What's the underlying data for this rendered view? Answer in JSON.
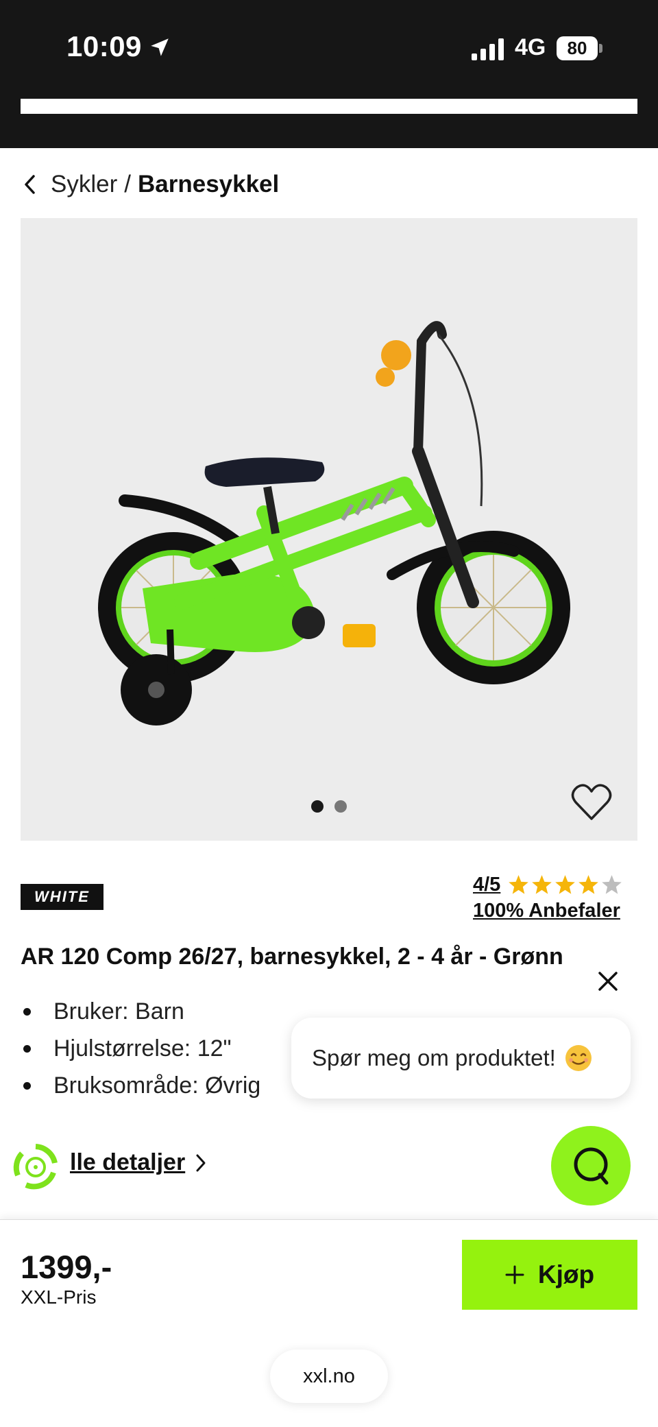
{
  "status_bar": {
    "time": "10:09",
    "network": "4G",
    "battery": "80"
  },
  "breadcrumb": {
    "parent": "Sykler",
    "separator": "/",
    "current": "Barnesykkel"
  },
  "gallery": {
    "image_count": 2,
    "active_index": 1
  },
  "product": {
    "brand": "WHITE",
    "rating": "4/5",
    "rating_stars": 4,
    "recommend": "100% Anbefaler",
    "title": "AR 120 Comp 26/27, barnesykkel, 2 - 4 år - Grønn",
    "specs": [
      {
        "label": "Bruker: Barn"
      },
      {
        "label": "Hjulstørrelse: 12\""
      },
      {
        "label": "Bruksområde: Øvrig"
      }
    ],
    "details_link": "lle detaljer"
  },
  "chat": {
    "bubble_text": "Spør meg om produktet!"
  },
  "purchase": {
    "price": "1399,-",
    "price_label": "XXL-Pris",
    "buy_label": "Kjøp"
  },
  "browser": {
    "domain": "xxl.no"
  },
  "colors": {
    "accent_green": "#95f20e",
    "star_yellow": "#f5b50a",
    "status_bar_bg": "#161616"
  },
  "icons": [
    "location-arrow-icon",
    "signal-icon",
    "back-chevron-icon",
    "heart-icon",
    "star-icon",
    "close-icon",
    "smile-emoji-icon",
    "eco-icon",
    "chevron-right-icon",
    "chat-icon",
    "plus-icon"
  ]
}
